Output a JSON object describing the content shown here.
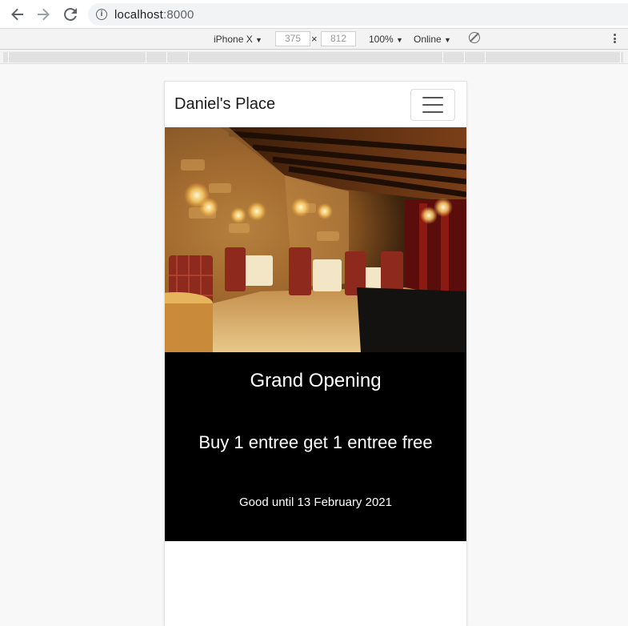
{
  "browser": {
    "url_host": "localhost",
    "url_port": ":8000"
  },
  "device_toolbar": {
    "device": "iPhone X",
    "width": "375",
    "height": "812",
    "zoom": "100%",
    "network": "Online"
  },
  "page": {
    "brand": "Daniel's Place",
    "promo": {
      "title": "Grand Opening",
      "offer": "Buy 1 entree get 1 entree free",
      "validity": "Good until 13 February 2021"
    }
  }
}
